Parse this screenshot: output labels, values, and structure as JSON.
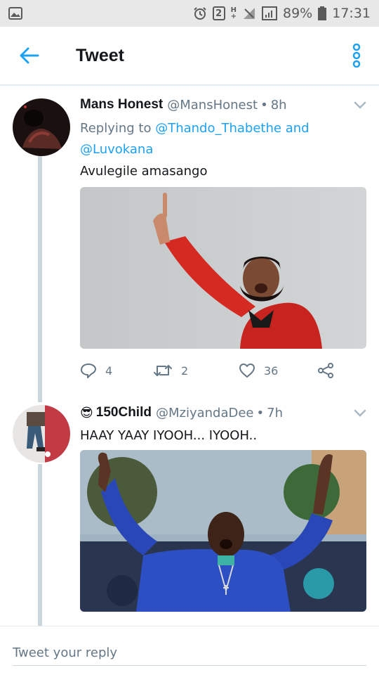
{
  "status_bar": {
    "notification_count": "2",
    "network_letter": "H",
    "network_sub": "+",
    "battery": "89%",
    "time": "17:31"
  },
  "app_bar": {
    "title": "Tweet"
  },
  "tweets": [
    {
      "name": "Mans Honest",
      "handle": "@MansHonest",
      "time": "8h",
      "replying_label": "Replying to",
      "mention_1": "@Thando_Thabethe",
      "and_label": "and",
      "mention_2": "@Luvokana",
      "text": "Avulegile amasango",
      "replies": "4",
      "retweets": "2",
      "likes": "36"
    },
    {
      "emoji": "😎",
      "name": "150Child",
      "handle": "@MziyandaDee",
      "time": "7h",
      "text": "HAAY YAAY IYOOH... IYOOH.."
    }
  ],
  "reply_bar": {
    "placeholder": "Tweet your reply"
  },
  "colors": {
    "accent": "#1da1f2",
    "muted": "#657786",
    "thread_line": "#ccd6dd"
  }
}
